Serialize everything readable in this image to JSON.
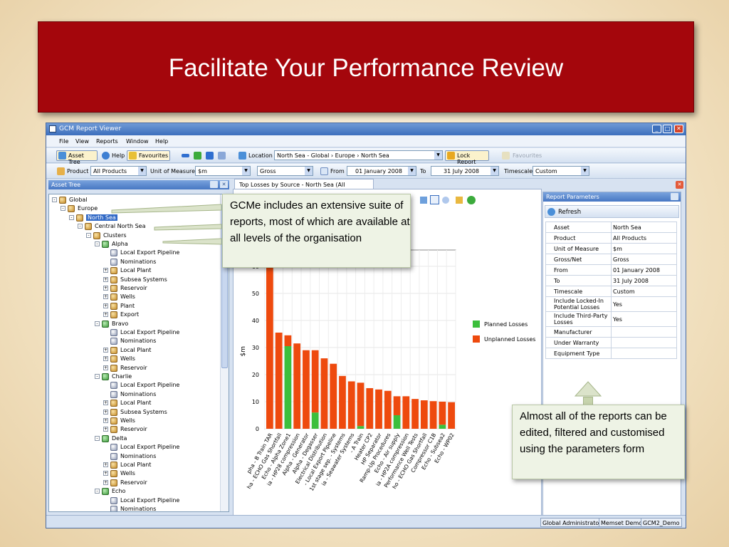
{
  "slide": {
    "title": "Facilitate Your Performance Review"
  },
  "app": {
    "window_title": "GCM Report Viewer",
    "menu": [
      "File",
      "View",
      "Reports",
      "Window",
      "Help"
    ],
    "toolbar1": {
      "asset_tree_label": "Asset Tree",
      "help_label": "Help",
      "favourites_label": "Favourites",
      "location_label": "Location",
      "location_value": "North Sea - Global › Europe › North Sea",
      "lock_report_label": "Lock Report",
      "favourites_disabled_label": "Favourites"
    },
    "toolbar2": {
      "product_label": "Product",
      "product_value": "All Products",
      "uom_label": "Unit of Measure",
      "uom_value": "$m",
      "gross_value": "Gross",
      "from_label": "From",
      "from_value": "01 January 2008",
      "to_label": "To",
      "to_value": "31 July 2008",
      "timescale_label": "Timescale",
      "timescale_value": "Custom"
    },
    "asset_tree": {
      "title": "Asset Tree",
      "nodes": [
        {
          "label": "Global",
          "depth": 0,
          "icon": "cylinder-icon",
          "expander": "-"
        },
        {
          "label": "Europe",
          "depth": 1,
          "icon": "cylinder-icon",
          "expander": "-"
        },
        {
          "label": "North Sea",
          "depth": 2,
          "icon": "cylinder-icon",
          "expander": "-",
          "selected": true
        },
        {
          "label": "Central North Sea",
          "depth": 3,
          "icon": "cylinder-icon",
          "expander": "-"
        },
        {
          "label": "Clusters",
          "depth": 4,
          "icon": "cylinder-icon",
          "expander": "-"
        },
        {
          "label": "Alpha",
          "depth": 5,
          "icon": "platform-icon",
          "expander": "-"
        },
        {
          "label": "Local Export Pipeline",
          "depth": 6,
          "icon": "pipeline-icon",
          "expander": ""
        },
        {
          "label": "Nominations",
          "depth": 6,
          "icon": "pipeline-icon",
          "expander": ""
        },
        {
          "label": "Local Plant",
          "depth": 6,
          "icon": "cylinder-icon",
          "expander": "+"
        },
        {
          "label": "Subsea Systems",
          "depth": 6,
          "icon": "cylinder-icon",
          "expander": "+"
        },
        {
          "label": "Reservoir",
          "depth": 6,
          "icon": "cylinder-icon",
          "expander": "+"
        },
        {
          "label": "Wells",
          "depth": 6,
          "icon": "cylinder-icon",
          "expander": "+"
        },
        {
          "label": "Plant",
          "depth": 6,
          "icon": "cylinder-icon",
          "expander": "+"
        },
        {
          "label": "Export",
          "depth": 6,
          "icon": "cylinder-icon",
          "expander": "+"
        },
        {
          "label": "Bravo",
          "depth": 5,
          "icon": "platform-icon",
          "expander": "-"
        },
        {
          "label": "Local Export Pipeline",
          "depth": 6,
          "icon": "pipeline-icon",
          "expander": ""
        },
        {
          "label": "Nominations",
          "depth": 6,
          "icon": "pipeline-icon",
          "expander": ""
        },
        {
          "label": "Local Plant",
          "depth": 6,
          "icon": "cylinder-icon",
          "expander": "+"
        },
        {
          "label": "Wells",
          "depth": 6,
          "icon": "cylinder-icon",
          "expander": "+"
        },
        {
          "label": "Reservoir",
          "depth": 6,
          "icon": "cylinder-icon",
          "expander": "+"
        },
        {
          "label": "Charlie",
          "depth": 5,
          "icon": "platform-icon",
          "expander": "-"
        },
        {
          "label": "Local Export Pipeline",
          "depth": 6,
          "icon": "pipeline-icon",
          "expander": ""
        },
        {
          "label": "Nominations",
          "depth": 6,
          "icon": "pipeline-icon",
          "expander": ""
        },
        {
          "label": "Local Plant",
          "depth": 6,
          "icon": "cylinder-icon",
          "expander": "+"
        },
        {
          "label": "Subsea Systems",
          "depth": 6,
          "icon": "cylinder-icon",
          "expander": "+"
        },
        {
          "label": "Wells",
          "depth": 6,
          "icon": "cylinder-icon",
          "expander": "+"
        },
        {
          "label": "Reservoir",
          "depth": 6,
          "icon": "cylinder-icon",
          "expander": "+"
        },
        {
          "label": "Delta",
          "depth": 5,
          "icon": "platform-icon",
          "expander": "-"
        },
        {
          "label": "Local Export Pipeline",
          "depth": 6,
          "icon": "pipeline-icon",
          "expander": ""
        },
        {
          "label": "Nominations",
          "depth": 6,
          "icon": "pipeline-icon",
          "expander": ""
        },
        {
          "label": "Local Plant",
          "depth": 6,
          "icon": "cylinder-icon",
          "expander": "+"
        },
        {
          "label": "Wells",
          "depth": 6,
          "icon": "cylinder-icon",
          "expander": "+"
        },
        {
          "label": "Reservoir",
          "depth": 6,
          "icon": "cylinder-icon",
          "expander": "+"
        },
        {
          "label": "Echo",
          "depth": 5,
          "icon": "platform-icon",
          "expander": "-"
        },
        {
          "label": "Local Export Pipeline",
          "depth": 6,
          "icon": "pipeline-icon",
          "expander": ""
        },
        {
          "label": "Nominations",
          "depth": 6,
          "icon": "pipeline-icon",
          "expander": ""
        }
      ]
    },
    "report_tab": {
      "label": "Top Losses by Source - North Sea (All Products)"
    },
    "report_parameters": {
      "title": "Report Parameters",
      "refresh_label": "Refresh",
      "rows": [
        {
          "key": "Asset",
          "value": "North Sea"
        },
        {
          "key": "Product",
          "value": "All Products"
        },
        {
          "key": "Unit of Measure",
          "value": "$m"
        },
        {
          "key": "Gross/Net",
          "value": "Gross"
        },
        {
          "key": "From",
          "value": "01 January 2008"
        },
        {
          "key": "To",
          "value": "31 July 2008"
        },
        {
          "key": "Timescale",
          "value": "Custom"
        },
        {
          "key": "Include Locked-In Potential Losses",
          "value": "Yes"
        },
        {
          "key": "Include Third-Party Losses",
          "value": "Yes"
        },
        {
          "key": "Manufacturer",
          "value": ""
        },
        {
          "key": "Under Warranty",
          "value": ""
        },
        {
          "key": "Equipment Type",
          "value": ""
        }
      ]
    },
    "status": [
      "Global Administrator",
      "Memset Demo",
      "GCM2_Demo"
    ]
  },
  "callouts": {
    "top": "GCMe includes an extensive suite of reports, most of which are available at all levels of the organisation",
    "bottom": "Almost all of the reports can be edited, filtered and customised using the parameters form"
  },
  "chart_data": {
    "type": "bar",
    "stacked": true,
    "ylabel": "$m",
    "ylim": [
      0,
      66
    ],
    "yticks": [
      0,
      10,
      20,
      30,
      40,
      50,
      60
    ],
    "grid": true,
    "legend_position": "right",
    "colors": {
      "Planned Losses": "#3cbf3c",
      "Unplanned Losses": "#ee4a0e"
    },
    "categories": [
      "pha - B Train TAR",
      "ha - ECHO Gas Shortfall",
      "Echo - Alpha Zone1",
      "ia - HP28 compression",
      "Alpha - Generator",
      "Alpha - Degasser",
      "Electrical Distribution",
      "- Local Export Pipeline",
      "1st stage sep. - Systems",
      "ia - Seawater Systems",
      "- A Train",
      "Heater CP2",
      "HP Separator",
      "Ramp-Up Procedures",
      "Echo - Air supply",
      "ia - HP2A compression",
      "Performance Well Tests",
      "ho - ECHO Gas Shortfall",
      "Compressor C1B",
      "Echo - Subsea2",
      "Echo - WP02"
    ],
    "series": [
      {
        "name": "Planned Losses",
        "values": [
          0,
          0,
          30.5,
          0,
          0,
          6,
          0,
          0,
          0,
          0,
          1,
          0,
          0,
          0,
          5,
          0,
          0,
          0,
          0,
          1.5,
          0
        ]
      },
      {
        "name": "Unplanned Losses",
        "values": [
          66,
          35.5,
          4,
          31.5,
          29,
          23,
          26,
          24,
          19.5,
          17.5,
          16,
          15,
          14.5,
          14,
          7,
          12,
          11,
          10.5,
          10.2,
          8.5,
          9.8
        ]
      }
    ]
  }
}
